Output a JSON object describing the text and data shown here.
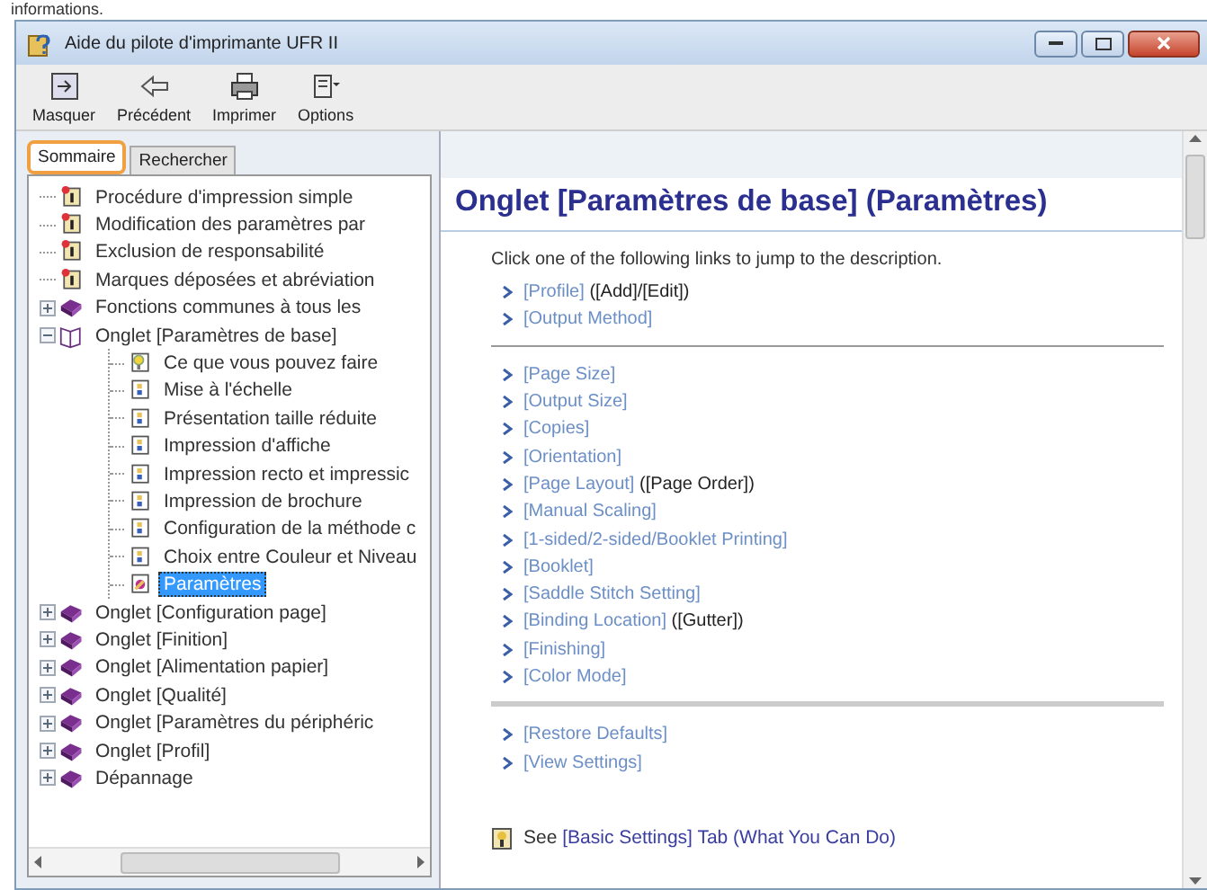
{
  "page_fragment": "informations.",
  "window": {
    "title": "Aide du pilote d'imprimante UFR II"
  },
  "toolbar": [
    {
      "kind": "hide",
      "label": "Masquer"
    },
    {
      "kind": "back",
      "label": "Précédent"
    },
    {
      "kind": "print",
      "label": "Imprimer"
    },
    {
      "kind": "options",
      "label": "Options"
    }
  ],
  "nav_tabs": [
    {
      "label": "Sommaire",
      "selected": true
    },
    {
      "label": "Rechercher",
      "selected": false
    }
  ],
  "tree": [
    {
      "kind": "page",
      "label": "Procédure d'impression simple",
      "selected": false
    },
    {
      "kind": "page",
      "label": "Modification des paramètres par",
      "selected": false
    },
    {
      "kind": "page",
      "label": "Exclusion de responsabilité",
      "selected": false
    },
    {
      "kind": "page",
      "label": "Marques déposées et abréviation",
      "selected": false
    },
    {
      "kind": "book",
      "label": "Fonctions communes à tous les",
      "selected": false,
      "expanded": false
    },
    {
      "kind": "book",
      "label": "Onglet [Paramètres de base]",
      "selected": false,
      "expanded": true,
      "children": [
        {
          "kind": "idea",
          "label": "Ce que vous pouvez faire",
          "selected": false
        },
        {
          "kind": "doc",
          "label": "Mise à l'échelle",
          "selected": false
        },
        {
          "kind": "doc",
          "label": "Présentation taille réduite",
          "selected": false
        },
        {
          "kind": "doc",
          "label": "Impression d'affiche",
          "selected": false
        },
        {
          "kind": "doc",
          "label": "Impression recto et impressic",
          "selected": false
        },
        {
          "kind": "doc",
          "label": "Impression de brochure",
          "selected": false
        },
        {
          "kind": "doc",
          "label": "Configuration de la méthode c",
          "selected": false
        },
        {
          "kind": "doc",
          "label": "Choix entre Couleur et Niveau",
          "selected": false
        },
        {
          "kind": "settings",
          "label": "Paramètres",
          "selected": true
        }
      ]
    },
    {
      "kind": "book",
      "label": "Onglet [Configuration page]",
      "selected": false,
      "expanded": false
    },
    {
      "kind": "book",
      "label": "Onglet [Finition]",
      "selected": false,
      "expanded": false
    },
    {
      "kind": "book",
      "label": "Onglet [Alimentation papier]",
      "selected": false,
      "expanded": false
    },
    {
      "kind": "book",
      "label": "Onglet [Qualité]",
      "selected": false,
      "expanded": false
    },
    {
      "kind": "book",
      "label": "Onglet [Paramètres du périphéric",
      "selected": false,
      "expanded": false
    },
    {
      "kind": "book",
      "label": "Onglet [Profil]",
      "selected": false,
      "expanded": false
    },
    {
      "kind": "book",
      "label": "Dépannage",
      "selected": false,
      "expanded": false
    }
  ],
  "content": {
    "heading": "Onglet [Paramètres de base] (Paramètres)",
    "intro": "Click one of the following links to jump to the description.",
    "link_groups": [
      [
        {
          "link": "[Profile]",
          "note": "([Add]/[Edit])"
        },
        {
          "link": "[Output Method]"
        }
      ],
      [
        {
          "link": "[Page Size]"
        },
        {
          "link": "[Output Size]"
        },
        {
          "link": "[Copies]"
        },
        {
          "link": "[Orientation]"
        },
        {
          "link": "[Page Layout]",
          "note": "([Page Order])"
        },
        {
          "link": "[Manual Scaling]"
        },
        {
          "link": "[1-sided/2-sided/Booklet Printing]"
        },
        {
          "link": "[Booklet]"
        },
        {
          "link": "[Saddle Stitch Setting]"
        },
        {
          "link": "[Binding Location]",
          "note": "([Gutter])"
        },
        {
          "link": "[Finishing]"
        },
        {
          "link": "[Color Mode]"
        }
      ],
      [
        {
          "link": "[Restore Defaults]"
        },
        {
          "link": "[View Settings]"
        }
      ]
    ],
    "see": {
      "prefix": "See",
      "link": "[Basic Settings] Tab (What You Can Do)"
    }
  }
}
